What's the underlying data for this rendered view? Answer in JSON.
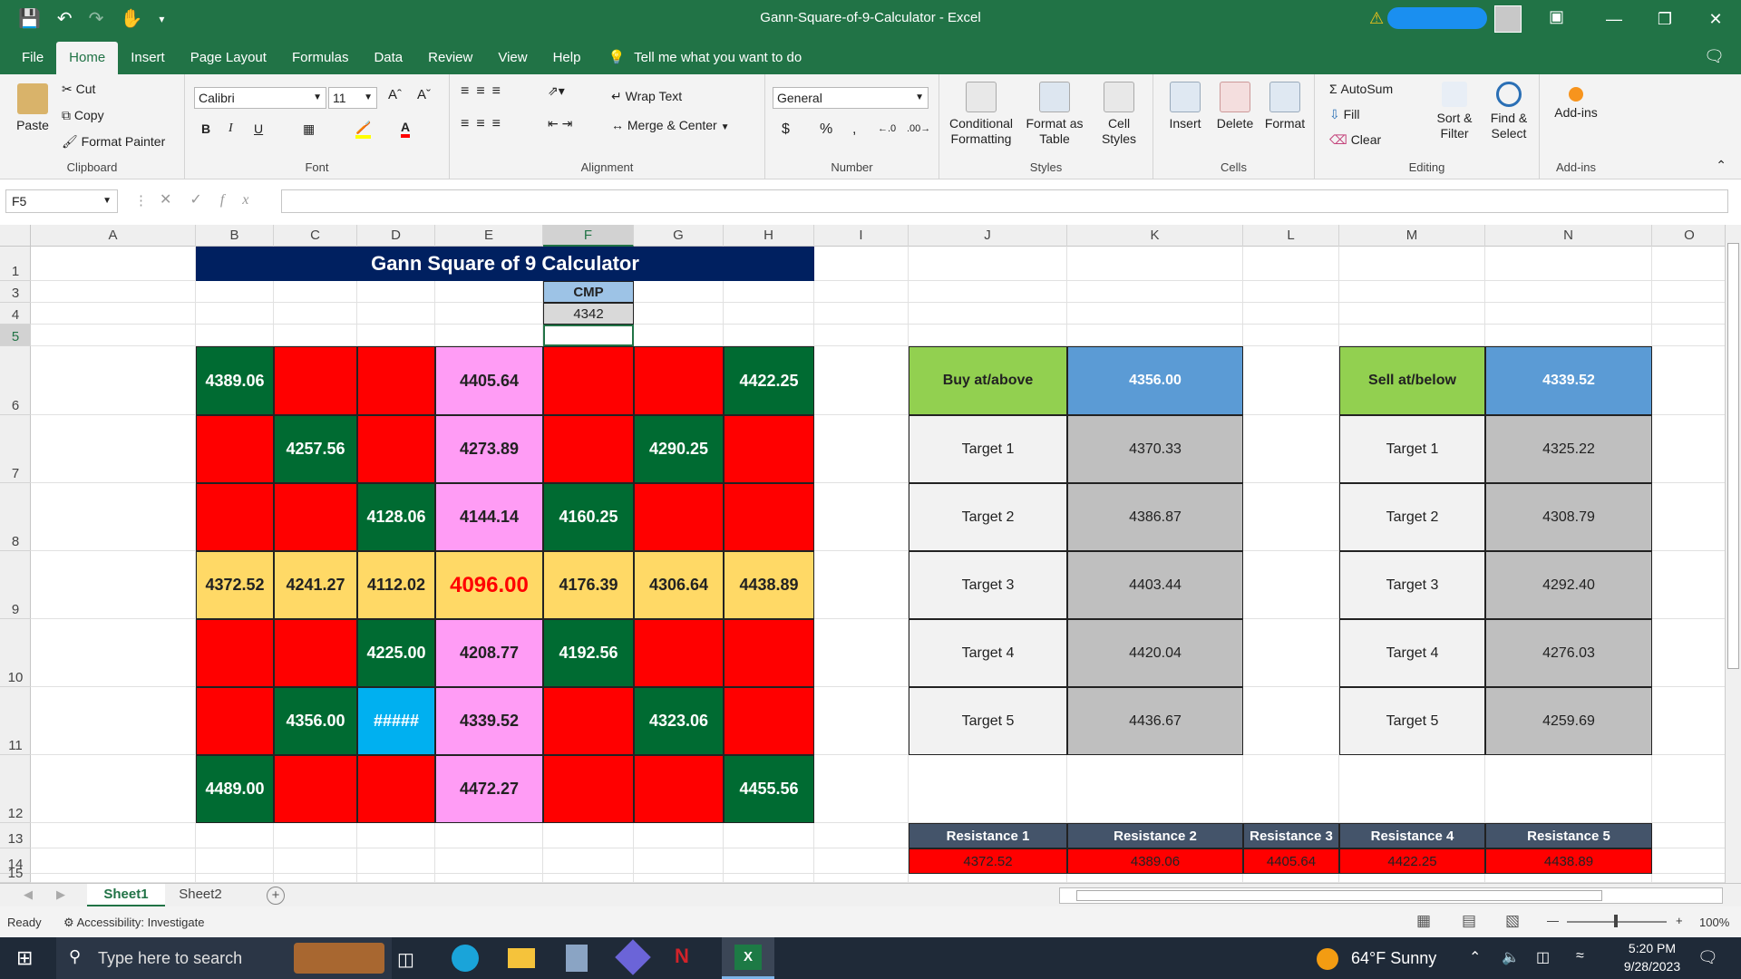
{
  "window": {
    "title": "Gann-Square-of-9-Calculator  -  Excel"
  },
  "tabs": [
    "File",
    "Home",
    "Insert",
    "Page Layout",
    "Formulas",
    "Data",
    "Review",
    "View",
    "Help"
  ],
  "tell_me": "Tell me what you want to do",
  "ribbon": {
    "clipboard": {
      "paste": "Paste",
      "cut": "Cut",
      "copy": "Copy",
      "format_painter": "Format Painter",
      "label": "Clipboard"
    },
    "font": {
      "name": "Calibri",
      "size": "11",
      "label": "Font"
    },
    "alignment": {
      "wrap": "Wrap Text",
      "merge": "Merge & Center",
      "label": "Alignment"
    },
    "number": {
      "format": "General",
      "label": "Number"
    },
    "styles": {
      "conditional": "Conditional Formatting",
      "format_table": "Format as Table",
      "cell_styles": "Cell Styles",
      "label": "Styles"
    },
    "cells": {
      "insert": "Insert",
      "delete": "Delete",
      "format": "Format",
      "label": "Cells"
    },
    "editing": {
      "autosum": "AutoSum",
      "fill": "Fill",
      "clear": "Clear",
      "sort": "Sort & Filter",
      "find": "Find & Select",
      "label": "Editing"
    },
    "addins": {
      "addins": "Add-ins",
      "label": "Add-ins"
    }
  },
  "formula_bar": {
    "name_box": "F5",
    "fx": "fx",
    "value": ""
  },
  "columns": [
    "A",
    "B",
    "C",
    "D",
    "E",
    "F",
    "G",
    "H",
    "I",
    "J",
    "K",
    "L",
    "M",
    "N",
    "O"
  ],
  "rows": [
    "1",
    "3",
    "4",
    "5",
    "6",
    "7",
    "8",
    "9",
    "10",
    "11",
    "12",
    "13",
    "14",
    "15"
  ],
  "sheet": {
    "title": "Gann Square of 9 Calculator",
    "cmp_label": "CMP",
    "cmp_value": "4342",
    "grid": [
      [
        "4389.06",
        "",
        "",
        "4405.64",
        "",
        "",
        "4422.25"
      ],
      [
        "",
        "4257.56",
        "",
        "4273.89",
        "",
        "4290.25",
        ""
      ],
      [
        "",
        "",
        "4128.06",
        "4144.14",
        "4160.25",
        "",
        ""
      ],
      [
        "4372.52",
        "4241.27",
        "4112.02",
        "4096.00",
        "4176.39",
        "4306.64",
        "4438.89"
      ],
      [
        "",
        "",
        "4225.00",
        "4208.77",
        "4192.56",
        "",
        ""
      ],
      [
        "",
        "4356.00",
        "#####",
        "4339.52",
        "",
        "4323.06",
        ""
      ],
      [
        "4489.00",
        "",
        "",
        "4472.27",
        "",
        "",
        "4455.56"
      ]
    ],
    "grid_colors": [
      [
        "green",
        "red",
        "red",
        "pink",
        "red",
        "red",
        "green"
      ],
      [
        "red",
        "green",
        "red",
        "pink",
        "red",
        "green",
        "red"
      ],
      [
        "red",
        "red",
        "green",
        "pink",
        "green",
        "red",
        "red"
      ],
      [
        "yellow",
        "yellow",
        "yellow",
        "yellow",
        "yellow",
        "yellow",
        "yellow"
      ],
      [
        "red",
        "red",
        "green",
        "pink",
        "green",
        "red",
        "red"
      ],
      [
        "red",
        "green",
        "cyan",
        "pink",
        "red",
        "green",
        "red"
      ],
      [
        "green",
        "red",
        "red",
        "pink",
        "red",
        "red",
        "green"
      ]
    ],
    "buy": {
      "label": "Buy at/above",
      "value": "4356.00",
      "targets": [
        {
          "label": "Target 1",
          "value": "4370.33"
        },
        {
          "label": "Target 2",
          "value": "4386.87"
        },
        {
          "label": "Target 3",
          "value": "4403.44"
        },
        {
          "label": "Target 4",
          "value": "4420.04"
        },
        {
          "label": "Target 5",
          "value": "4436.67"
        }
      ]
    },
    "sell": {
      "label": "Sell at/below",
      "value": "4339.52",
      "targets": [
        {
          "label": "Target 1",
          "value": "4325.22"
        },
        {
          "label": "Target 2",
          "value": "4308.79"
        },
        {
          "label": "Target 3",
          "value": "4292.40"
        },
        {
          "label": "Target 4",
          "value": "4276.03"
        },
        {
          "label": "Target 5",
          "value": "4259.69"
        }
      ]
    },
    "resistance": [
      {
        "label": "Resistance 1",
        "value": "4372.52"
      },
      {
        "label": "Resistance 2",
        "value": "4389.06"
      },
      {
        "label": "Resistance 3",
        "value": "4405.64"
      },
      {
        "label": "Resistance 4",
        "value": "4422.25"
      },
      {
        "label": "Resistance 5",
        "value": "4438.89"
      }
    ]
  },
  "sheets": [
    "Sheet1",
    "Sheet2"
  ],
  "status": {
    "ready": "Ready",
    "accessibility": "Accessibility: Investigate",
    "zoom": "100%"
  },
  "taskbar": {
    "search": "Type here to search",
    "weather": "64°F  Sunny",
    "time": "5:20 PM",
    "date": "9/28/2023"
  },
  "colors": {
    "excel_green": "#217346",
    "red": "#ff0000",
    "dark_green": "#006b32",
    "pink": "#ff9cf5",
    "yellow": "#ffd966",
    "cyan": "#00b0f0",
    "navy": "#002060",
    "light_green": "#92d050",
    "blue": "#5b9bd5",
    "grey": "#bfbfbf",
    "slate": "#44546a"
  }
}
